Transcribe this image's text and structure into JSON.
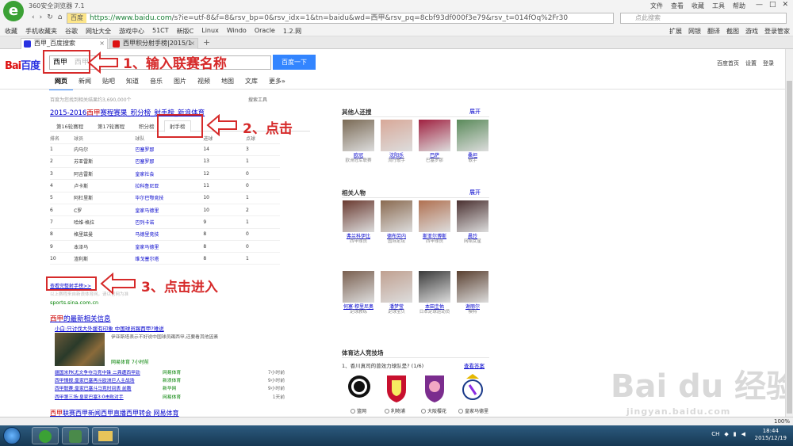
{
  "browser": {
    "title": "360安全浏览器 7.1",
    "menus": [
      "文件",
      "查看",
      "收藏",
      "工具",
      "帮助"
    ],
    "url_site": "百度",
    "url_host": "https://www.baidu.com",
    "url_rest": "/s?ie=utf-8&f=8&rsv_bp=0&rsv_idx=1&tn=baidu&wd=西甲&rsv_pq=8cbf93df000f3e79&rsv_t=014fOq%2Fr30",
    "search_placeholder": "点此搜索",
    "bookmarks": [
      "收藏",
      "手机收藏夹",
      "谷歌",
      "网址大全",
      "游戏中心",
      "51CT",
      "新版C",
      "Linux",
      "Windo",
      "Oracle",
      "1.2.网"
    ],
    "bookmarks_right": [
      "扩展",
      "网银",
      "翻译",
      "截图",
      "游戏",
      "登录管家"
    ],
    "tabs": [
      {
        "label": "西甲_百度搜索"
      },
      {
        "label": "西甲积分射手榜|2015/1"
      }
    ],
    "zoom": "100%"
  },
  "baidu": {
    "logo_red": "Bai",
    "logo_blue": "百度",
    "query": "西甲",
    "query_ghost": "西甲",
    "search_button": "百度一下",
    "header_links": [
      "百度首页",
      "设置",
      "登录"
    ],
    "nav": [
      "网页",
      "新闻",
      "贴吧",
      "知道",
      "音乐",
      "图片",
      "视频",
      "地图",
      "文库",
      "更多»"
    ],
    "results_info": "百度为您找到相关结果约3,690,000个",
    "search_tools": "搜索工具"
  },
  "result": {
    "title_prefix": "2015-2016",
    "title_em": "西甲",
    "title_rest": "赛程赛果_积分榜_射手榜_新浪体育",
    "tabs": [
      "第16轮赛程",
      "第17轮赛程",
      "积分榜",
      "射手榜"
    ],
    "table_headers": [
      "排名",
      "球员",
      "球队",
      "进球",
      "点球"
    ],
    "rows": [
      {
        "rank": "1",
        "player": "内马尔",
        "team": "巴塞罗那",
        "goals": "14",
        "pen": "3"
      },
      {
        "rank": "2",
        "player": "苏亚雷斯",
        "team": "巴塞罗那",
        "goals": "13",
        "pen": "1"
      },
      {
        "rank": "3",
        "player": "阿吉雷斯",
        "team": "皇家社会",
        "goals": "12",
        "pen": "0"
      },
      {
        "rank": "4",
        "player": "卢卡斯",
        "team": "拉科鲁尼亚",
        "goals": "11",
        "pen": "0"
      },
      {
        "rank": "5",
        "player": "阿杜里斯",
        "team": "毕尔巴鄂竞技",
        "goals": "10",
        "pen": "1"
      },
      {
        "rank": "6",
        "player": "C罗",
        "team": "皇家马德里",
        "goals": "10",
        "pen": "2"
      },
      {
        "rank": "7",
        "player": "哈维·格拉",
        "team": "巴列卡诺",
        "goals": "9",
        "pen": "1"
      },
      {
        "rank": "8",
        "player": "格里兹曼",
        "team": "马德里竞技",
        "goals": "8",
        "pen": "0"
      },
      {
        "rank": "9",
        "player": "本泽马",
        "team": "皇家马德里",
        "goals": "8",
        "pen": "0"
      },
      {
        "rank": "10",
        "player": "渣利斯",
        "team": "维戈塞尔塔",
        "goals": "8",
        "pen": "1"
      }
    ],
    "more_link": "查看完整射手榜>>",
    "gray_snippet": "以上赛程来自新浪体育网，请以官网为准",
    "source": "sports.sina.com.cn"
  },
  "news": {
    "title_em": "西甲",
    "title_rest": "的最新相关信息",
    "sub": "小白:只讨伐大外援有印象 中国球员踢西甲?难说",
    "desc": "伊亚斯塔表示不好说中国球员踢西甲,还要看其他因素",
    "meta": "网易体育  7小时前",
    "list": [
      {
        "title": "疆国米PK尤文争夺马竞中锋 二弗遭西甲劲",
        "src": "网易体育",
        "date": "7小时前"
      },
      {
        "title": "西甲情报:皇家巴塞再斗欧洲巨人主战场",
        "src": "新浪体育",
        "date": "9小时前"
      },
      {
        "title": "西甲联赛:皇家巴塞斗马竞时间表 前瞻",
        "src": "新华网",
        "date": "9小时前"
      },
      {
        "title": "西甲第三场:皇家巴塞3:0击败对手",
        "src": "网易体育",
        "date": "1天前"
      }
    ],
    "more_prefix": "西甲",
    "more_rest": "联赛西甲新闻西甲直播西甲转会  网易体育"
  },
  "right_panel": {
    "others_title": "其他人还搜",
    "others_fold": "展开",
    "others": [
      {
        "name": "欧冠",
        "desc": "欧洲冠军联赛",
        "color": "#7a6a55"
      },
      {
        "name": "沈阳乐",
        "desc": "流行歌手",
        "color": "#d8a898"
      },
      {
        "name": "巴萨",
        "desc": "巴塞罗那",
        "color": "#a02040"
      },
      {
        "name": "桑坦",
        "desc": "歌手",
        "color": "#5a8a5a"
      }
    ],
    "people_title": "相关人物",
    "people_fold": "展开",
    "people": [
      {
        "name": "弗兰科伊比",
        "desc": "西甲球员",
        "color": "#6a3a30"
      },
      {
        "name": "德布劳内",
        "desc": "国际足坛",
        "color": "#8a6a50"
      },
      {
        "name": "斯亚尔博斯",
        "desc": "西甲球员",
        "color": "#b07050"
      },
      {
        "name": "晨玲",
        "desc": "网络女星",
        "color": "#4a3030"
      },
      {
        "name": "何塞·穆里尼奥",
        "desc": "足球教练",
        "color": "#7a6050"
      },
      {
        "name": "潘梦莹",
        "desc": "足球宝贝",
        "color": "#c0a090"
      },
      {
        "name": "本田圭佑",
        "desc": "日本足球运动员",
        "color": "#3a3a3a"
      },
      {
        "name": "谢丽尔",
        "desc": "模特",
        "color": "#5a4030"
      }
    ],
    "quiz_title": "体育达人竞技场",
    "quiz_q": "1、香川真司的曾效力球队是? (1/6)",
    "quiz_link": "查看答案",
    "options": [
      "篮网",
      "利物浦",
      "大阪樱花",
      "皇家马德里"
    ]
  },
  "callouts": [
    {
      "text": "1、输入联赛名称"
    },
    {
      "text": "2、点击"
    },
    {
      "text": "3、点击进入"
    }
  ],
  "watermark": {
    "main": "Bai du 经验",
    "sub": "jingyan.baidu.com"
  },
  "taskbar": {
    "time": "18:44",
    "date": "2015/12/19",
    "lang": "CH"
  }
}
